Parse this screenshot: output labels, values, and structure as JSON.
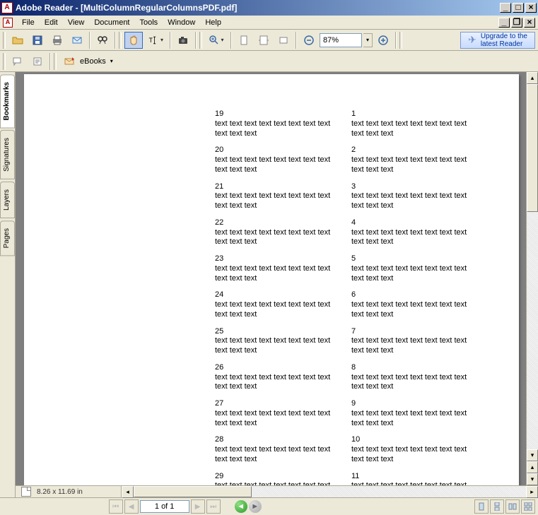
{
  "app": {
    "title": "Adobe Reader - [MultiColumnRegularColumnsPDF.pdf]"
  },
  "menu": {
    "items": [
      "File",
      "Edit",
      "View",
      "Document",
      "Tools",
      "Window",
      "Help"
    ]
  },
  "toolbar": {
    "zoom": "87%",
    "upgrade_line1": "Upgrade to the",
    "upgrade_line2": "latest Reader",
    "ebooks_label": "eBooks"
  },
  "tabs": [
    "Bookmarks",
    "Signatures",
    "Layers",
    "Pages"
  ],
  "status": {
    "dims": "8.26 x 11.69 in",
    "page": "1 of 1"
  },
  "doc": {
    "body_text": "text text text text text text text text text text text",
    "left_col": [
      "19",
      "20",
      "21",
      "22",
      "23",
      "24",
      "25",
      "26",
      "27",
      "28",
      "29"
    ],
    "right_col": [
      "1",
      "2",
      "3",
      "4",
      "5",
      "6",
      "7",
      "8",
      "9",
      "10",
      "11"
    ]
  }
}
